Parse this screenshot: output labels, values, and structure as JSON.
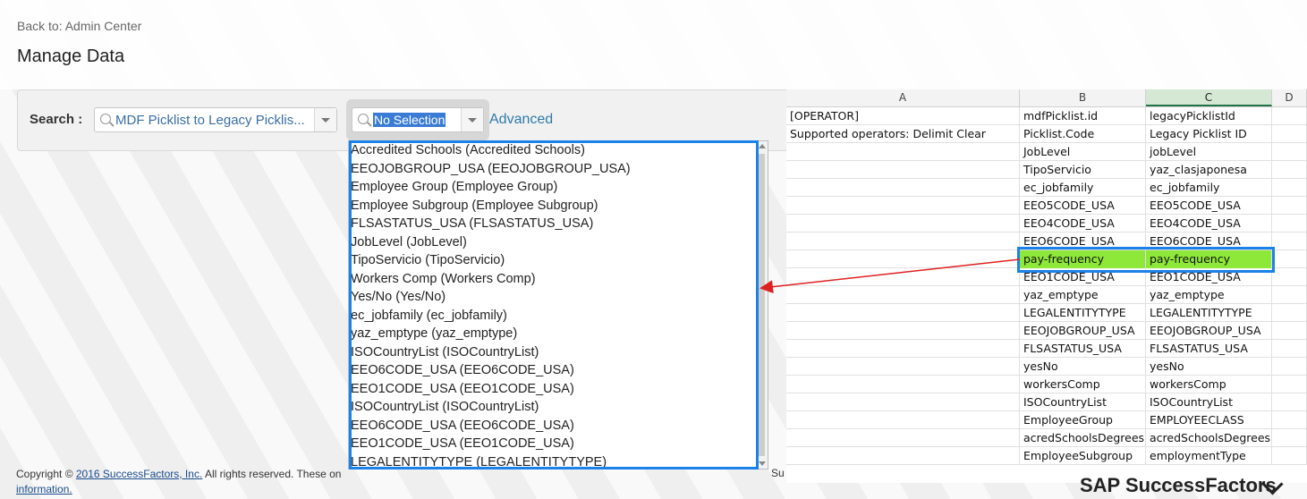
{
  "header": {
    "back_link": "Back to: Admin Center",
    "title": "Manage Data"
  },
  "search": {
    "label": "Search :",
    "type_value": "MDF Picklist to Legacy Picklis...",
    "selection_value": "No Selection",
    "advanced_label": "Advanced"
  },
  "dropdown": {
    "items": [
      "Accredited Schools (Accredited Schools)",
      "EEOJOBGROUP_USA (EEOJOBGROUP_USA)",
      "Employee Group (Employee Group)",
      "Employee Subgroup (Employee Subgroup)",
      "FLSASTATUS_USA (FLSASTATUS_USA)",
      "JobLevel (JobLevel)",
      "TipoServicio (TipoServicio)",
      "Workers Comp (Workers Comp)",
      "Yes/No (Yes/No)",
      "ec_jobfamily (ec_jobfamily)",
      "yaz_emptype (yaz_emptype)",
      "ISOCountryList (ISOCountryList)",
      "EEO6CODE_USA (EEO6CODE_USA)",
      "EEO1CODE_USA (EEO1CODE_USA)",
      "ISOCountryList (ISOCountryList)",
      "EEO6CODE_USA (EEO6CODE_USA)",
      "EEO1CODE_USA (EEO1CODE_USA)",
      "LEGALENTITYTYPE (LEGALENTITYTYPE)"
    ]
  },
  "footer": {
    "copyright_prefix": "Copyright © ",
    "copyright_link": "2016 SuccessFactors, Inc.",
    "copyright_suffix": " All rights reserved. These on",
    "info_link": "information.",
    "trailing": "Su",
    "logo": "SAP SuccessFactors"
  },
  "sheet": {
    "columns": [
      "A",
      "B",
      "C",
      "D"
    ],
    "selected_column": "C",
    "highlight_color": "#8ee83a",
    "rows": [
      {
        "a": "[OPERATOR]",
        "b": "mdfPicklist.id",
        "c": "legacyPicklistId"
      },
      {
        "a": "Supported operators: Delimit Clear",
        "b": "Picklist.Code",
        "c": "Legacy Picklist ID"
      },
      {
        "a": "",
        "b": "JobLevel",
        "c": "jobLevel"
      },
      {
        "a": "",
        "b": "TipoServicio",
        "c": "yaz_clasjaponesa"
      },
      {
        "a": "",
        "b": "ec_jobfamily",
        "c": "ec_jobfamily"
      },
      {
        "a": "",
        "b": "EEO5CODE_USA",
        "c": "EEO5CODE_USA"
      },
      {
        "a": "",
        "b": "EEO4CODE_USA",
        "c": "EEO4CODE_USA"
      },
      {
        "a": "",
        "b": "EEO6CODE_USA",
        "c": "EEO6CODE_USA"
      },
      {
        "a": "",
        "b": "pay-frequency",
        "c": "pay-frequency"
      },
      {
        "a": "",
        "b": "EEO1CODE_USA",
        "c": "EEO1CODE_USA"
      },
      {
        "a": "",
        "b": "yaz_emptype",
        "c": "yaz_emptype"
      },
      {
        "a": "",
        "b": "LEGALENTITYTYPE",
        "c": "LEGALENTITYTYPE"
      },
      {
        "a": "",
        "b": "EEOJOBGROUP_USA",
        "c": "EEOJOBGROUP_USA"
      },
      {
        "a": "",
        "b": "FLSASTATUS_USA",
        "c": "FLSASTATUS_USA"
      },
      {
        "a": "",
        "b": "yesNo",
        "c": "yesNo"
      },
      {
        "a": "",
        "b": "workersComp",
        "c": "workersComp"
      },
      {
        "a": "",
        "b": "ISOCountryList",
        "c": "ISOCountryList"
      },
      {
        "a": "",
        "b": "EmployeeGroup",
        "c": "EMPLOYEECLASS"
      },
      {
        "a": "",
        "b": "acredSchoolsDegrees",
        "c": "acredSchoolsDegrees"
      },
      {
        "a": "",
        "b": "EmployeeSubgroup",
        "c": "employmentType"
      }
    ],
    "highlighted_row": 8
  }
}
